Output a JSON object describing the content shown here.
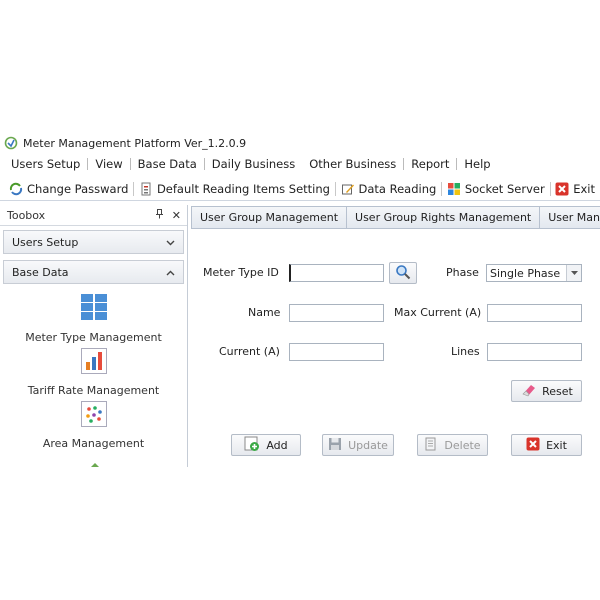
{
  "window": {
    "title": "Meter Management Platform Ver_1.2.0.9"
  },
  "menu": [
    "Users Setup",
    "View",
    "Base Data",
    "Daily Business",
    "Other Business",
    "Report",
    "Help"
  ],
  "toolbar": {
    "change_password": "Change Passward",
    "default_reading": "Default Reading Items Setting",
    "data_reading": "Data Reading",
    "socket_server": "Socket Server",
    "exit": "Exit"
  },
  "toolbox": {
    "title": "Toobox",
    "pin": "ᵖ",
    "close": "✕",
    "groups": [
      {
        "label": "Users Setup",
        "expanded": false
      },
      {
        "label": "Base Data",
        "expanded": true
      }
    ],
    "items": [
      "Meter Type Management",
      "Tariff Rate Management",
      "Area Management"
    ]
  },
  "tabs": [
    "User Group Management",
    "User Group Rights Management",
    "User Managem"
  ],
  "form": {
    "meter_type_id_label": "Meter Type ID",
    "meter_type_id_value": "",
    "phase_label": "Phase",
    "phase_value": "Single Phase",
    "name_label": "Name",
    "name_value": "",
    "max_current_label": "Max Current (A)",
    "max_current_value": "",
    "current_label": "Current (A)",
    "current_value": "",
    "lines_label": "Lines",
    "lines_value": ""
  },
  "buttons": {
    "reset": "Reset",
    "add": "Add",
    "update": "Update",
    "delete": "Delete",
    "exit": "Exit"
  },
  "colors": {
    "accent": "#3a78c2",
    "panel_border": "#b7c1cf",
    "exit_red": "#d9342b"
  }
}
